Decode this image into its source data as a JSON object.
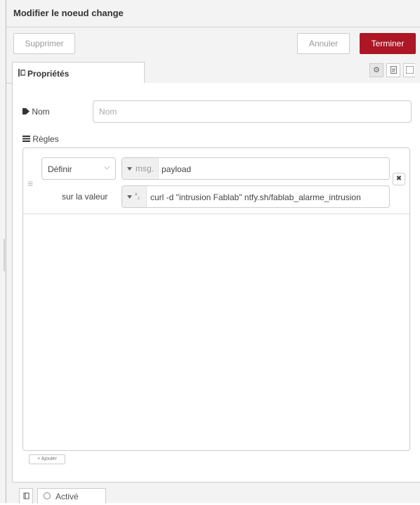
{
  "tray": {
    "title": "Modifier le noeud change"
  },
  "toolbar": {
    "delete_label": "Supprimer",
    "cancel_label": "Annuler",
    "done_label": "Terminer"
  },
  "tabs": [
    {
      "label": "Propriétés",
      "icon": "sliders-icon"
    }
  ],
  "side_buttons": [
    "gear-icon",
    "description-icon",
    "appearance-icon"
  ],
  "form": {
    "name": {
      "label": "Nom",
      "icon": "tag-icon",
      "value": "",
      "placeholder": "Nom"
    },
    "rules": {
      "label": "Règles",
      "icon": "list-icon",
      "items": [
        {
          "action": "Définir",
          "target_type": "msg.",
          "target": "payload",
          "to_label": "sur la valeur",
          "value_type": "string",
          "value": "curl -d \"intrusion Fablab\" ntfy.sh/fablab_alarme_intrusion"
        }
      ]
    },
    "add_label": "+ Ajouter"
  },
  "footer": {
    "toggle_label": "Activé"
  },
  "colors": {
    "done_button": "#ad1625",
    "tray_background": "#f3f3f3"
  }
}
